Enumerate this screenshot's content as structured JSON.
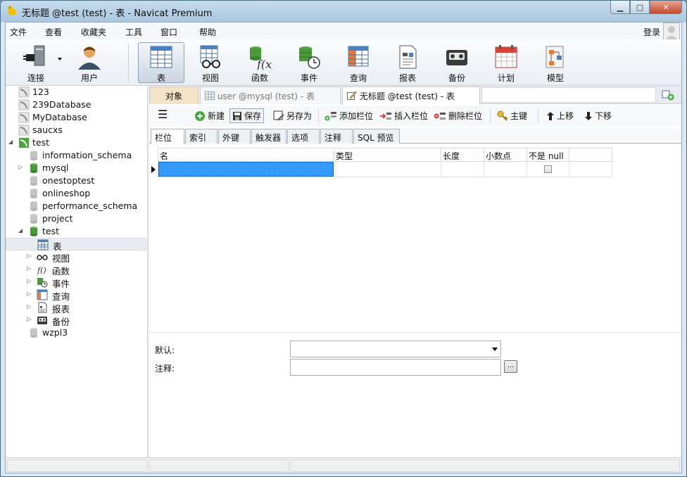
{
  "window": {
    "title": "无标题 @test (test) - 表 - Navicat Premium",
    "minimize_glyph": "▁",
    "maximize_glyph": "□",
    "close_glyph": "✕"
  },
  "menu": {
    "items": [
      "文件",
      "查看",
      "收藏夹",
      "工具",
      "窗口",
      "帮助"
    ],
    "login": "登录"
  },
  "toolbar": {
    "items": [
      {
        "label": "连接",
        "icon": "plug-icon"
      },
      {
        "label": "用户",
        "icon": "user-icon"
      },
      {
        "label": "表",
        "icon": "table-icon"
      },
      {
        "label": "视图",
        "icon": "view-icon"
      },
      {
        "label": "函数",
        "icon": "function-icon"
      },
      {
        "label": "事件",
        "icon": "event-icon"
      },
      {
        "label": "查询",
        "icon": "query-icon"
      },
      {
        "label": "报表",
        "icon": "report-icon"
      },
      {
        "label": "备份",
        "icon": "backup-icon"
      },
      {
        "label": "计划",
        "icon": "schedule-icon"
      },
      {
        "label": "模型",
        "icon": "model-icon"
      }
    ],
    "active": "表"
  },
  "sidebar": {
    "connections": [
      {
        "name": "123"
      },
      {
        "name": "239Database"
      },
      {
        "name": "MyDatabase"
      },
      {
        "name": "saucxs"
      },
      {
        "name": "test"
      }
    ],
    "databases": [
      {
        "name": "information_schema"
      },
      {
        "name": "mysql"
      },
      {
        "name": "onestoptest"
      },
      {
        "name": "onlineshop"
      },
      {
        "name": "performance_schema"
      },
      {
        "name": "project"
      },
      {
        "name": "test"
      }
    ],
    "objects": [
      {
        "name": "表"
      },
      {
        "name": "视图"
      },
      {
        "name": "函数"
      },
      {
        "name": "事件"
      },
      {
        "name": "查询"
      },
      {
        "name": "报表"
      },
      {
        "name": "备份"
      }
    ],
    "last": {
      "name": "wzpl3"
    }
  },
  "tabs": {
    "objects": "对象",
    "inactive": "user @mysql (test) - 表",
    "current": "无标题 @test (test) - 表"
  },
  "edit_toolbar": {
    "menu_glyph": "☰",
    "new": "新建",
    "save": "保存",
    "save_as": "另存为",
    "add_field": "添加栏位",
    "insert_field": "插入栏位",
    "delete_field": "删除栏位",
    "primary_key": "主键",
    "move_up": "上移",
    "move_down": "下移"
  },
  "sub_tabs": [
    "栏位",
    "索引",
    "外键",
    "触发器",
    "选项",
    "注释",
    "SQL 预览"
  ],
  "grid": {
    "columns": [
      "名",
      "类型",
      "长度",
      "小数点",
      "不是 null"
    ]
  },
  "props": {
    "default_label": "默认:",
    "comment_label": "注释:",
    "browse_glyph": "..."
  },
  "colors": {
    "selection": "#3399ff",
    "objects_tab": "#f4e3c6"
  }
}
